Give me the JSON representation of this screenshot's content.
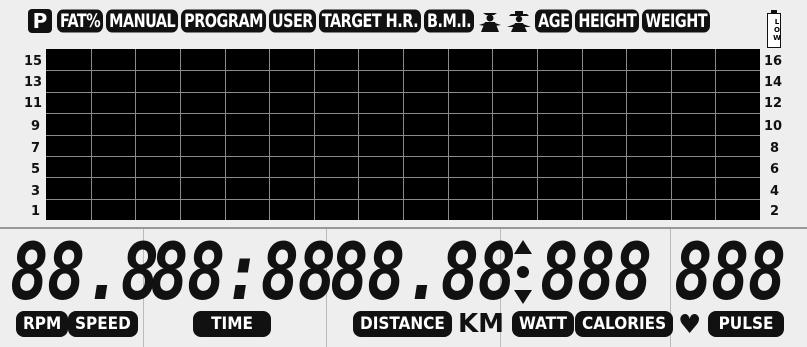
{
  "top_bar": {
    "p_icon": "P",
    "badges": [
      "FAT%",
      "MANUAL",
      "PROGRAM",
      "USER",
      "TARGET H.R.",
      "B.M.I."
    ],
    "badges2": [
      "AGE",
      "HEIGHT",
      "WEIGHT"
    ],
    "battery_label": "LOW"
  },
  "y_left": [
    "15",
    "13",
    "11",
    "9",
    "7",
    "5",
    "3",
    "1"
  ],
  "y_right": [
    "16",
    "14",
    "12",
    "10",
    "8",
    "6",
    "4",
    "2"
  ],
  "displays": {
    "rpm_speed": "88.8",
    "time": "88:88",
    "distance": "88.88",
    "watt_calories": "888",
    "pulse": "888"
  },
  "labels": {
    "rpm": "RPM",
    "speed": "SPEED",
    "time": "TIME",
    "distance": "DISTANCE",
    "km": "KM",
    "watt": "WATT",
    "calories": "CALORIES",
    "pulse": "PULSE"
  }
}
